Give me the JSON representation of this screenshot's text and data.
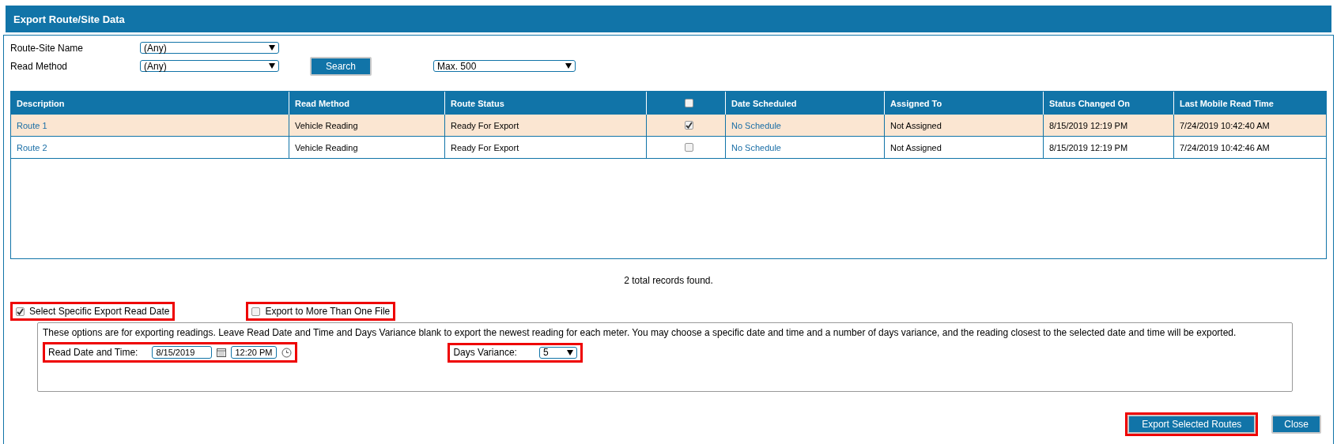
{
  "window": {
    "title": "Export Route/Site Data"
  },
  "filters": [
    {
      "label": "Route-Site Name",
      "value": "(Any)"
    },
    {
      "label": "Read Method",
      "value": "(Any)"
    }
  ],
  "search_button": "Search",
  "max_select": {
    "value": "Max. 500"
  },
  "table": {
    "columns": [
      "Description",
      "Read Method",
      "Route Status",
      "",
      "Date Scheduled",
      "Assigned To",
      "Status Changed On",
      "Last Mobile Read Time"
    ],
    "header_checked": false,
    "rows": [
      {
        "description": "Route 1",
        "read_method": "Vehicle Reading",
        "route_status": "Ready For Export",
        "selected": true,
        "date_scheduled": "No Schedule",
        "assigned_to": "Not Assigned",
        "status_changed_on": "8/15/2019 12:19 PM",
        "last_mobile_read_time": "7/24/2019 10:42:40 AM"
      },
      {
        "description": "Route 2",
        "read_method": "Vehicle Reading",
        "route_status": "Ready For Export",
        "selected": false,
        "date_scheduled": "No Schedule",
        "assigned_to": "Not Assigned",
        "status_changed_on": "8/15/2019 12:19 PM",
        "last_mobile_read_time": "7/24/2019 10:42:46 AM"
      }
    ]
  },
  "record_count": "2 total records found.",
  "options": [
    {
      "label": "Select Specific Export Read Date",
      "checked": true,
      "highlighted": true
    },
    {
      "label": "Export to More Than One File",
      "checked": false,
      "highlighted": true
    }
  ],
  "export_panel": {
    "note": "These options are for exporting readings. Leave Read Date and Time and Days Variance blank to export the newest reading for each meter. You may choose a specific date and time and a number of days variance, and the reading closest to the selected date and time will be exported.",
    "read_date": {
      "label": "Read Date and Time:",
      "date": "8/15/2019",
      "time": "12:20 PM",
      "highlighted": true
    },
    "days_variance": {
      "label": "Days Variance:",
      "value": "5",
      "highlighted": true
    }
  },
  "buttons": [
    {
      "label": "Export Selected Routes",
      "highlighted": true
    },
    {
      "label": "Close",
      "highlighted": false
    }
  ]
}
